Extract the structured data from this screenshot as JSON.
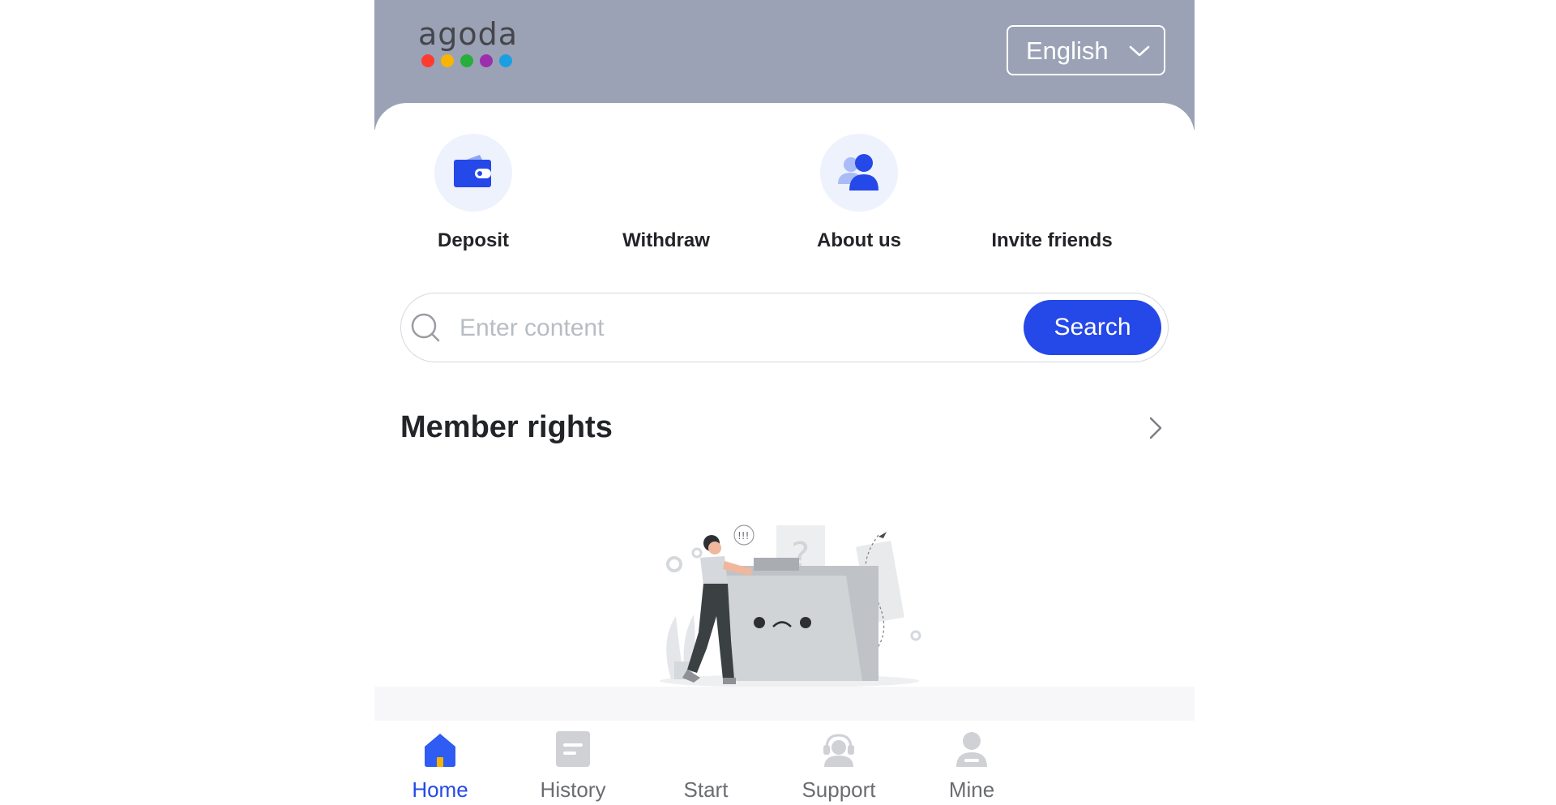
{
  "brand": {
    "logo_text": "agoda",
    "dot_colors": [
      "#ff3b30",
      "#f8b400",
      "#27ae3c",
      "#9b2fae",
      "#1a9fe0"
    ]
  },
  "header": {
    "language": "English",
    "background_color": "#9ba2b5"
  },
  "quick_actions": [
    {
      "label": "Deposit",
      "icon": "wallet-icon"
    },
    {
      "label": "Withdraw",
      "icon": ""
    },
    {
      "label": "About us",
      "icon": "people-icon"
    },
    {
      "label": "Invite friends",
      "icon": ""
    }
  ],
  "search": {
    "placeholder": "Enter content",
    "value": "",
    "button_label": "Search"
  },
  "member_rights": {
    "title": "Member rights"
  },
  "tabbar": {
    "items": [
      {
        "label": "Home",
        "icon": "home-icon",
        "active": true
      },
      {
        "label": "History",
        "icon": "document-icon",
        "active": false
      },
      {
        "label": "Start",
        "icon": "",
        "active": false
      },
      {
        "label": "Support",
        "icon": "headset-icon",
        "active": false
      },
      {
        "label": "Mine",
        "icon": "user-icon",
        "active": false
      }
    ]
  },
  "colors": {
    "accent": "#2548e8",
    "text": "#222428",
    "muted": "#6a6c72"
  }
}
